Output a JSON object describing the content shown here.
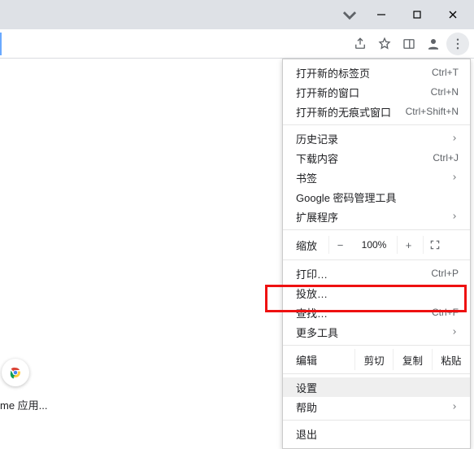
{
  "menu": {
    "new_tab": "打开新的标签页",
    "new_tab_sc": "Ctrl+T",
    "new_window": "打开新的窗口",
    "new_window_sc": "Ctrl+N",
    "incognito": "打开新的无痕式窗口",
    "incognito_sc": "Ctrl+Shift+N",
    "history": "历史记录",
    "downloads": "下载内容",
    "downloads_sc": "Ctrl+J",
    "bookmarks": "书签",
    "pwmgr": "Google 密码管理工具",
    "extensions": "扩展程序",
    "zoom_label": "缩放",
    "zoom_value": "100%",
    "print": "打印…",
    "print_sc": "Ctrl+P",
    "cast": "投放…",
    "find": "查找…",
    "find_sc": "Ctrl+F",
    "more_tools": "更多工具",
    "edit_label": "编辑",
    "cut": "剪切",
    "copy": "复制",
    "paste": "粘贴",
    "settings": "设置",
    "help": "帮助",
    "exit": "退出"
  },
  "bottom": {
    "app_label": "me 应用..."
  }
}
